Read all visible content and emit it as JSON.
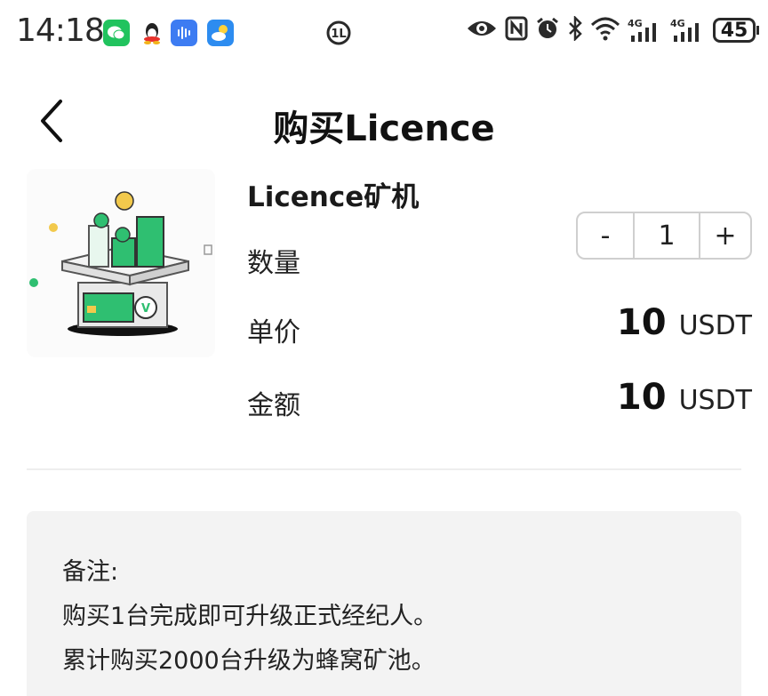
{
  "status_bar": {
    "time": "14:18",
    "battery": "45",
    "signal_1": "4G",
    "signal_2": "4G",
    "icons": [
      "wechat-icon",
      "qq-icon",
      "voice-assistant-icon",
      "weather-icon",
      "vpn-icon",
      "eye-icon",
      "nfc-icon",
      "alarm-icon",
      "bluetooth-icon",
      "wifi-icon",
      "signal-icon",
      "signal-icon",
      "battery-icon"
    ]
  },
  "header": {
    "title": "购买Licence",
    "back_icon": "chevron-left-icon"
  },
  "product": {
    "name": "Licence矿机",
    "image": "mining-machine-illustration",
    "quantity_label": "数量",
    "quantity_value": "1",
    "minus_label": "-",
    "plus_label": "+",
    "unit_price_label": "单价",
    "unit_price_value": "10",
    "unit_price_currency": "USDT",
    "amount_label": "金额",
    "amount_value": "10",
    "amount_currency": "USDT"
  },
  "note": {
    "title": "备注:",
    "line1": "购买1台完成即可升级正式经纪人。",
    "line2": "累计购买2000台升级为蜂窝矿池。"
  },
  "colors": {
    "accent_green": "#2fbf71",
    "note_background": "#f3f3f3",
    "divider": "#eeeeee"
  }
}
